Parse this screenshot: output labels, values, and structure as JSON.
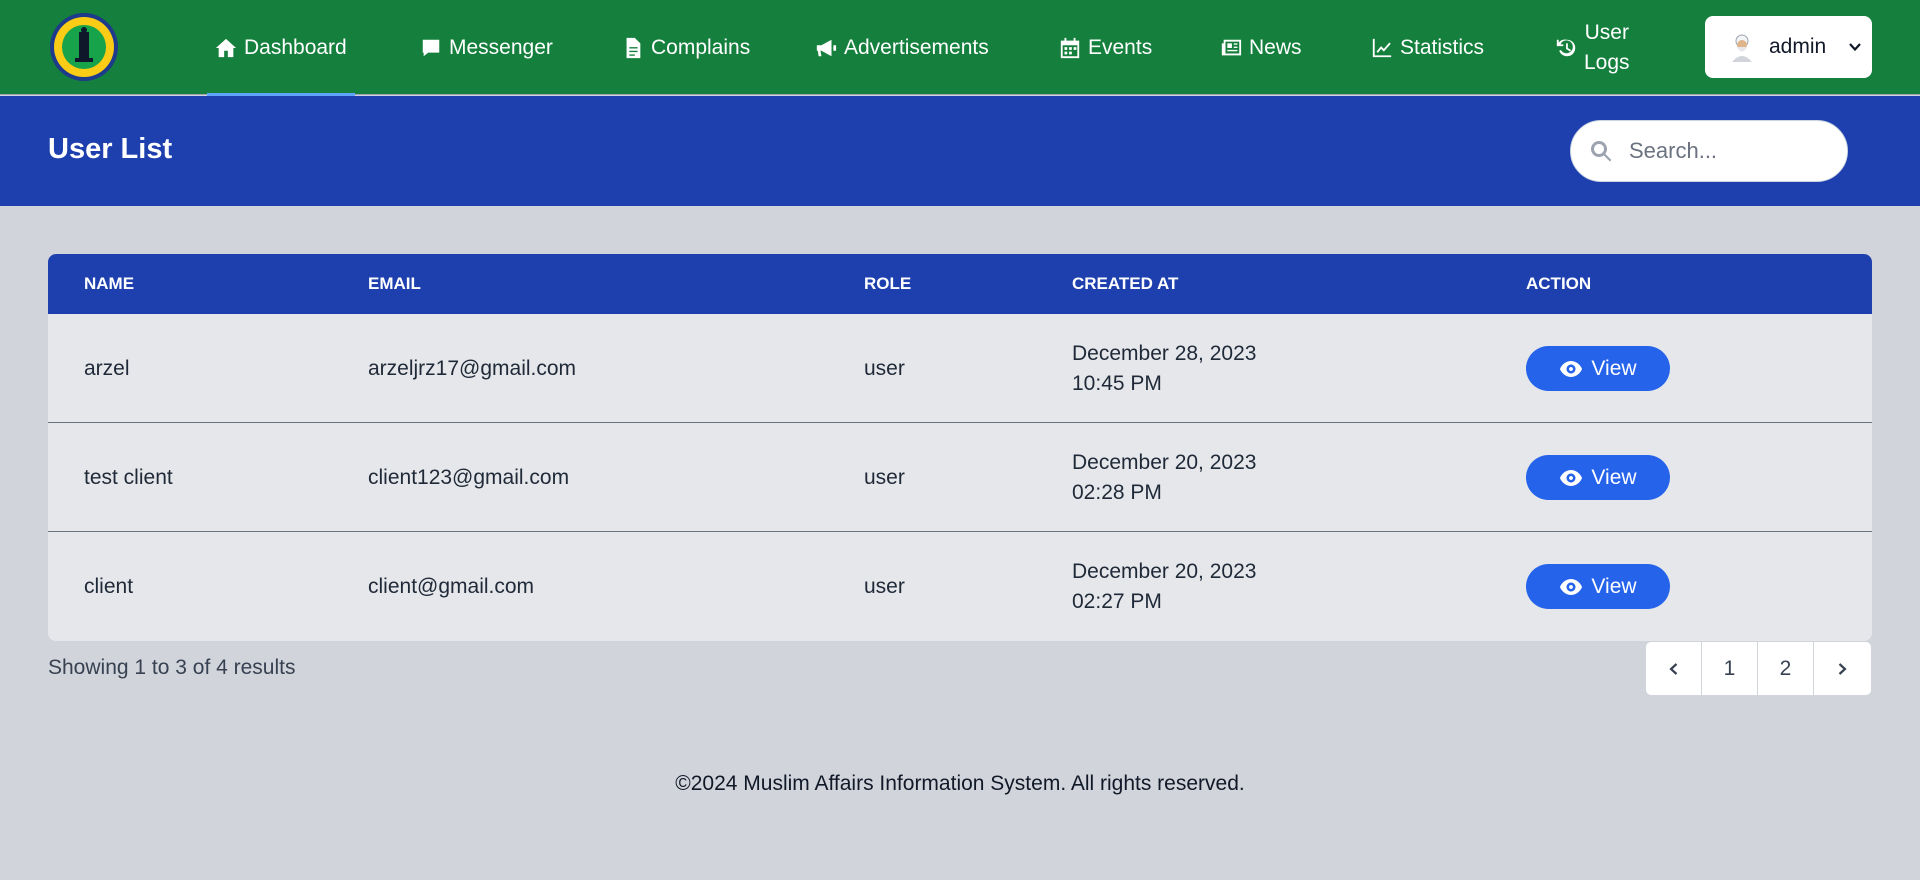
{
  "nav": {
    "items": [
      {
        "label": "Dashboard",
        "icon": "home-icon"
      },
      {
        "label": "Messenger",
        "icon": "chat-icon"
      },
      {
        "label": "Complains",
        "icon": "file-icon"
      },
      {
        "label": "Advertisements",
        "icon": "megaphone-icon"
      },
      {
        "label": "Events",
        "icon": "calendar-icon"
      },
      {
        "label": "News",
        "icon": "newspaper-icon"
      },
      {
        "label": "Statistics",
        "icon": "chart-line-icon"
      },
      {
        "label_line1": "User",
        "label_line2": "Logs",
        "icon": "history-icon"
      }
    ],
    "active": "Dashboard",
    "admin_label": "admin",
    "colors": {
      "bar": "#15803d",
      "active_underline": "#60a5fa"
    }
  },
  "header": {
    "title": "User List",
    "search_placeholder": "Search..."
  },
  "table": {
    "columns": [
      "NAME",
      "EMAIL",
      "ROLE",
      "CREATED AT",
      "ACTION"
    ],
    "rows": [
      {
        "name": "arzel",
        "email": "arzeljrz17@gmail.com",
        "role": "user",
        "date": "December 28, 2023",
        "time": "10:45 PM",
        "action": "View"
      },
      {
        "name": "test client",
        "email": "client123@gmail.com",
        "role": "user",
        "date": "December 20, 2023",
        "time": "02:28 PM",
        "action": "View"
      },
      {
        "name": "client",
        "email": "client@gmail.com",
        "role": "user",
        "date": "December 20, 2023",
        "time": "02:27 PM",
        "action": "View"
      }
    ],
    "header_color": "#1e40af",
    "button_color": "#2563eb"
  },
  "pagination": {
    "summary": "Showing 1 to 3 of 4 results",
    "pages": [
      "1",
      "2"
    ]
  },
  "footer": {
    "copyright": "©2024 Muslim Affairs Information System. All rights reserved."
  }
}
